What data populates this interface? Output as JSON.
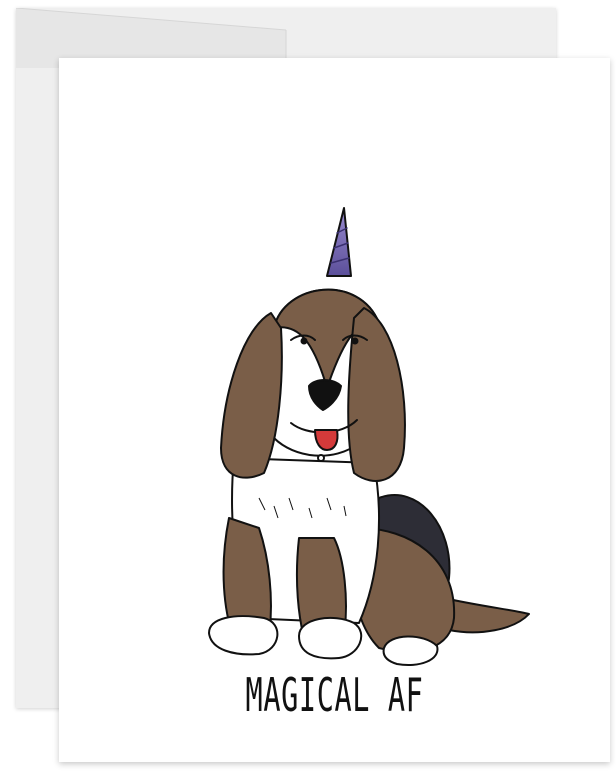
{
  "card": {
    "caption": "MAGICAL AF"
  },
  "colors": {
    "envelope": "#efefef",
    "card": "#ffffff",
    "dog_brown": "#7a5e48",
    "dog_dark": "#2d2d36",
    "horn": "#7a6ab0",
    "tongue": "#d43a3a",
    "ink": "#111111"
  },
  "icons": [
    "basset-hound-unicorn-illustration"
  ]
}
